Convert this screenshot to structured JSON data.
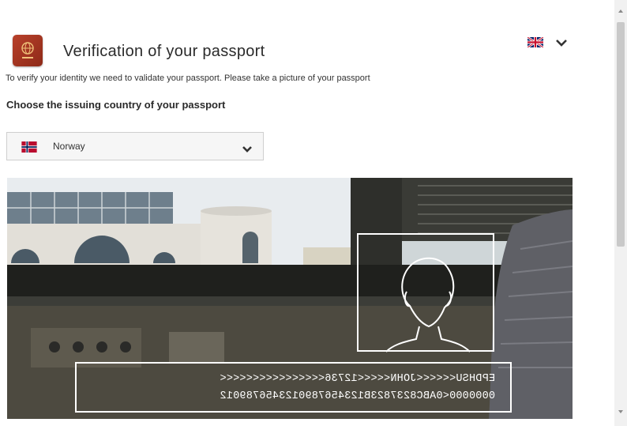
{
  "header": {
    "title": "Verification of your passport",
    "passport_icon": "passport-icon",
    "language_flag": "uk-flag-icon"
  },
  "intro": {
    "text": "To verify your identity we need to validate your passport. Please take a picture of your passport"
  },
  "country": {
    "label": "Choose the issuing country of your passport",
    "selected": "Norway",
    "flag": "norway-flag-icon"
  },
  "camera": {
    "mrz_line_1": "EPDHSU<<<<<<JOHN<<<<<12736<<<<<<<<<<<<<<<<",
    "mrz_line_2": "0000000<0ABC8237823B1234567890123456789012"
  },
  "colors": {
    "passport_red": "#b8412b",
    "overlay": "#ffffff",
    "select_bg": "#f6f6f6"
  }
}
